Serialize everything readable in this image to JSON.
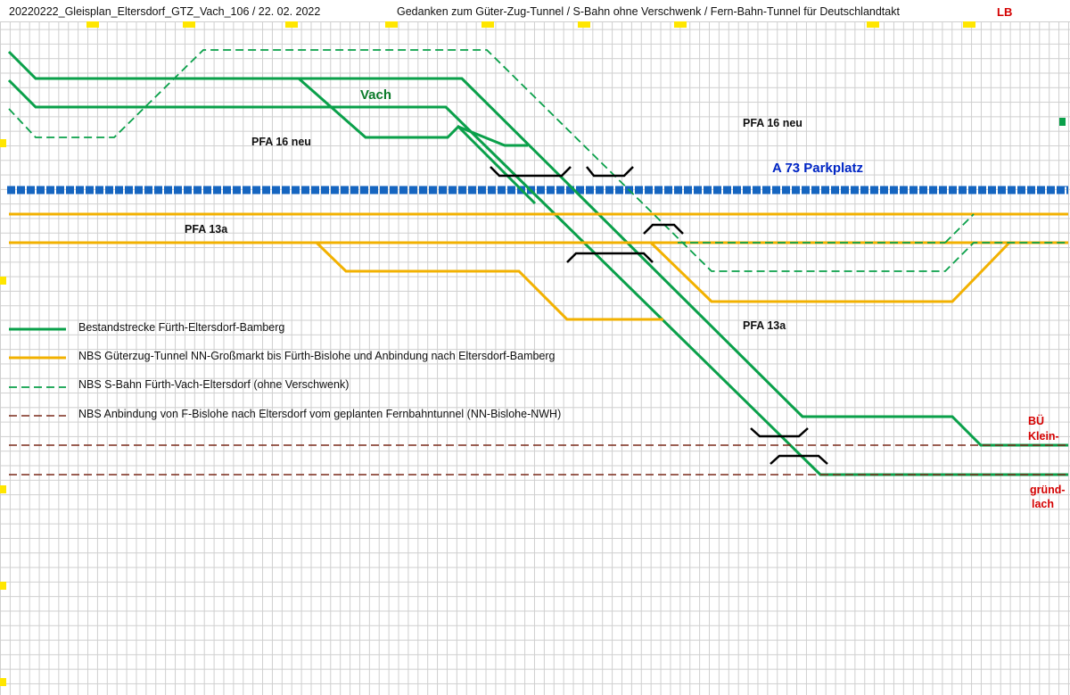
{
  "header": {
    "file_title": "20220222_Gleisplan_Eltersdorf_GTZ_Vach_106 / 22. 02. 2022",
    "subject": "Gedanken zum Güter-Zug-Tunnel / S-Bahn ohne Verschwenk / Fern-Bahn-Tunnel für Deutschlandtakt",
    "author_mark": "LB"
  },
  "labels": {
    "vach": "Vach",
    "pfa16_left": "PFA 16 neu",
    "pfa16_right": "PFA 16 neu",
    "a73": "A 73 Parkplatz",
    "pfa13a_left": "PFA 13a",
    "pfa13a_right": "PFA 13a",
    "bue_line1": "BÜ",
    "bue_line2": "Klein-",
    "gruend_line1": "gründ-",
    "gruend_line2": "lach"
  },
  "legend": [
    {
      "text": "Bestandstrecke Fürth-Eltersdorf-Bamberg",
      "color": "#0aa04a",
      "style": "solid"
    },
    {
      "text": "NBS Güterzug-Tunnel NN-Großmarkt bis Fürth-Bislohe und Anbindung nach Eltersdorf-Bamberg",
      "color": "#f2b100",
      "style": "solid"
    },
    {
      "text": "NBS S-Bahn Fürth-Vach-Eltersdorf (ohne Verschwenk)",
      "color": "#0aa04a",
      "style": "dashed"
    },
    {
      "text": "NBS Anbindung von F-Bislohe nach Eltersdorf vom geplanten Fernbahntunnel (NN-Bislohe-NWH)",
      "color": "#7a2a1a",
      "style": "dashed"
    }
  ],
  "colors": {
    "bestand": "#0aa04a",
    "gueterzug": "#f2b100",
    "sbahn": "#0aa04a",
    "fernbahn": "#7a2a1a",
    "autobahn": "#1565c0",
    "bridge": "#000000",
    "grid": "#cfcfcf",
    "marker": "#ffe600",
    "red_text": "#d40000"
  }
}
